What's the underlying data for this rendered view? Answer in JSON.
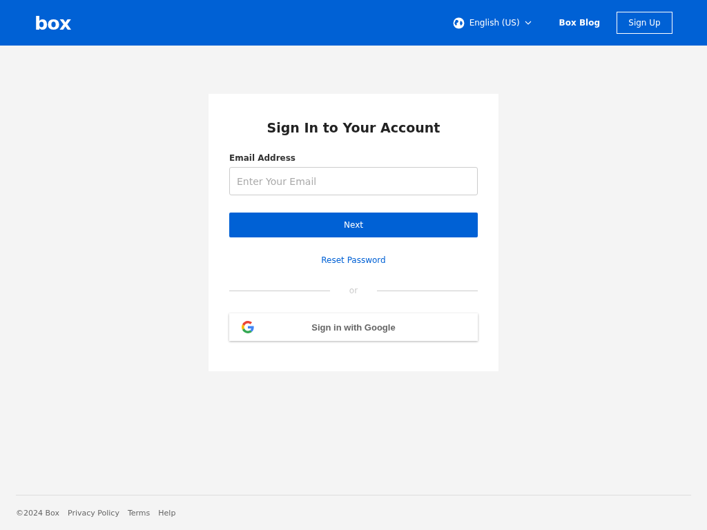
{
  "header": {
    "logo": "box",
    "language": "English (US)",
    "blog_link": "Box Blog",
    "signup_button": "Sign Up"
  },
  "login": {
    "title": "Sign In to Your Account",
    "email_label": "Email Address",
    "email_placeholder": "Enter Your Email",
    "next_button": "Next",
    "reset_link": "Reset Password",
    "divider": "or",
    "google_button": "Sign in with Google"
  },
  "footer": {
    "copyright": "©2024 Box",
    "links": [
      "Privacy Policy",
      "Terms",
      "Help"
    ]
  }
}
